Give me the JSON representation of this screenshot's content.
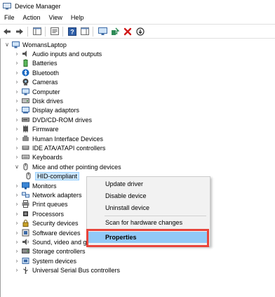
{
  "window": {
    "title": "Device Manager"
  },
  "menubar": [
    "File",
    "Action",
    "View",
    "Help"
  ],
  "toolbar": [
    "back-arrow-icon",
    "forward-arrow-icon",
    "show-hide-console-tree-icon",
    "properties-icon",
    "help-icon",
    "action-pane-icon",
    "monitor-icon",
    "update-driver-icon",
    "uninstall-icon",
    "disable-icon"
  ],
  "tree": {
    "root": "WomansLaptop",
    "items": [
      {
        "label": "Audio inputs and outputs",
        "icon": "speaker-icon"
      },
      {
        "label": "Batteries",
        "icon": "battery-icon"
      },
      {
        "label": "Bluetooth",
        "icon": "bluetooth-icon"
      },
      {
        "label": "Cameras",
        "icon": "camera-icon"
      },
      {
        "label": "Computer",
        "icon": "computer-icon"
      },
      {
        "label": "Disk drives",
        "icon": "disk-drive-icon"
      },
      {
        "label": "Display adaptors",
        "icon": "display-adapter-icon"
      },
      {
        "label": "DVD/CD-ROM drives",
        "icon": "dvd-drive-icon"
      },
      {
        "label": "Firmware",
        "icon": "firmware-icon"
      },
      {
        "label": "Human Interface Devices",
        "icon": "hid-icon"
      },
      {
        "label": "IDE ATA/ATAPI controllers",
        "icon": "ide-controller-icon"
      },
      {
        "label": "Keyboards",
        "icon": "keyboard-icon"
      },
      {
        "label": "Mice and other pointing devices",
        "icon": "mouse-icon",
        "expanded": true,
        "child": {
          "label": "HID-compliant",
          "icon": "mouse-icon"
        }
      },
      {
        "label": "Monitors",
        "icon": "monitor-icon"
      },
      {
        "label": "Network adapters",
        "icon": "network-adapter-icon"
      },
      {
        "label": "Print queues",
        "icon": "printer-icon"
      },
      {
        "label": "Processors",
        "icon": "processor-icon"
      },
      {
        "label": "Security devices",
        "icon": "security-device-icon"
      },
      {
        "label": "Software devices",
        "icon": "software-device-icon"
      },
      {
        "label": "Sound, video and ga",
        "icon": "sound-icon"
      },
      {
        "label": "Storage controllers",
        "icon": "storage-controller-icon"
      },
      {
        "label": "System devices",
        "icon": "system-device-icon"
      },
      {
        "label": "Universal Serial Bus controllers",
        "icon": "usb-icon"
      }
    ]
  },
  "context_menu": {
    "items": [
      "Update driver",
      "Disable device",
      "Uninstall device",
      "Scan for hardware changes",
      "Properties"
    ],
    "highlighted": "Properties"
  },
  "colors": {
    "selection": "#cce8ff",
    "menu_highlight": "#91c9f7",
    "annotation_box": "#e8453c"
  }
}
